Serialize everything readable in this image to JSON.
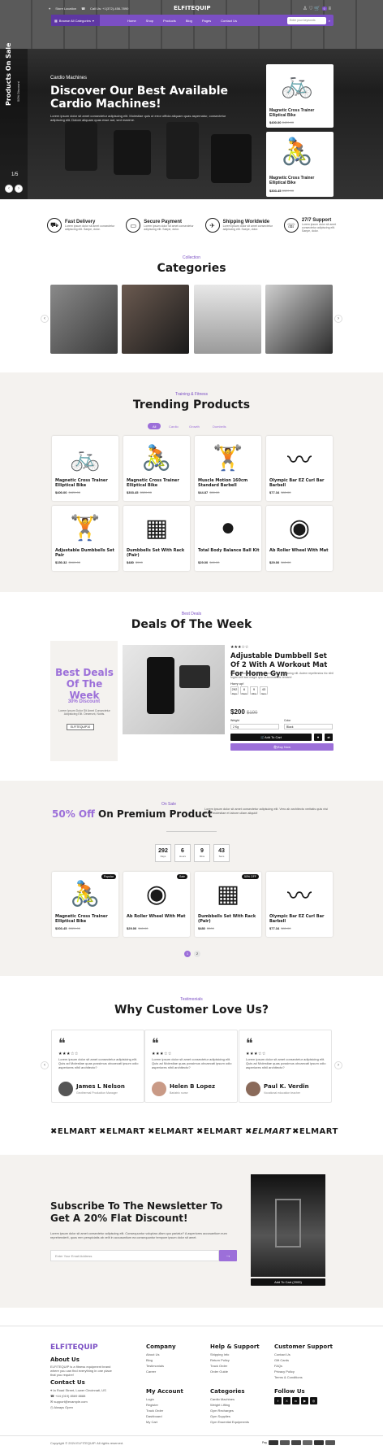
{
  "topbar": {
    "location": "Store Location",
    "phone": "Call Us: +1(372)-456-7890"
  },
  "nav": {
    "logo": "ELFITEQUIP",
    "browse": "Browse All Categories",
    "items": [
      "Home",
      "Shop",
      "Products",
      "Blog",
      "Pages",
      "Contact Us"
    ],
    "search_placeholder": "Enter your keywords",
    "cart_count": "0"
  },
  "hero": {
    "side_title": "Products On Sale",
    "side_sub": "50% Discount",
    "counter": "1/5",
    "eyebrow": "Cardio Machines",
    "title": "Discover Our Best Available Cardio Machines!",
    "desc": "Lorem ipsum dolor sit amet consectetur adipiscing elit. Molestiae quis ut error officia aliquam quas aspernatur, consectetur adipiscing elit. Dolore aliquam quas esse aut, sed maxime.",
    "cards": [
      {
        "name": "Magnetic Cross Trainer Elliptical Bike",
        "price": "$400.00",
        "old": "$420.00"
      },
      {
        "name": "Magnetic Cross Trainer Elliptical Bike",
        "price": "$303.45",
        "old": "$320.00"
      }
    ]
  },
  "features": [
    {
      "title": "Fast Delivery",
      "desc": "Lorem ipsum dolor sit amet consectetur adipiscing elit. Saepe, dolor."
    },
    {
      "title": "Secure Payment",
      "desc": "Lorem ipsum dolor sit amet consectetur adipiscing elit. Saepe, dolor."
    },
    {
      "title": "Shipping Worldwide",
      "desc": "Lorem ipsum dolor sit amet consectetur adipiscing elit. Saepe, dolor."
    },
    {
      "title": "27/7 Support",
      "desc": "Lorem ipsum dolor sit amet consectetur adipiscing elit. Saepe, dolor."
    }
  ],
  "categories": {
    "eyebrow": "Collection",
    "title": "Categories"
  },
  "trending": {
    "eyebrow": "Training & Fitness",
    "title": "Trending Products",
    "tabs": [
      "All",
      "Cardio",
      "Growth",
      "Dumbells"
    ],
    "products": [
      {
        "name": "Magnetic Cross Trainer Elliptical Bike",
        "price": "$400.00",
        "old": "$420.00",
        "icon": "🚲"
      },
      {
        "name": "Magnetic Cross Trainer Elliptical Bike",
        "price": "$303.45",
        "old": "$320.00",
        "icon": "🚴"
      },
      {
        "name": "Muscle Motion 160cm Standard Barbell",
        "price": "$44.87",
        "old": "$50.00",
        "icon": "🏋"
      },
      {
        "name": "Olympic Bar EZ Curl Bar Barbell",
        "price": "$77.34",
        "old": "$80.00",
        "icon": "〰"
      },
      {
        "name": "Adjustable Dumbbells Set Pair",
        "price": "$150.32",
        "old": "$160.00",
        "icon": "🏋"
      },
      {
        "name": "Dumbbells Set With Rack (Pair)",
        "price": "$480",
        "old": "$500",
        "icon": "▦"
      },
      {
        "name": "Total Body Balance Ball Kit",
        "price": "$29.00",
        "old": "$40.00",
        "icon": "●"
      },
      {
        "name": "Ab Roller Wheel With Mat",
        "price": "$29.00",
        "old": "$40.00",
        "icon": "◉"
      }
    ]
  },
  "deals": {
    "eyebrow": "Best Deals",
    "title": "Deals Of The Week",
    "promo_title": "Best Deals Of The Week",
    "promo_discount": "30% Discount",
    "promo_desc": "Lorem Ipsum Dolor Sit Amet Consectetur Adipisicing Elit. Deserunt, Nobis.",
    "promo_code": "ELFITEQUIP10",
    "product": "Adjustable Dumbbell Set Of 2 With A Workout Mat For Home Gym",
    "desc": "Lorem ipsum dolor sit amet consectetur adipiscing elit. Autem repellendus hic nihil fugiat velit sed magni quo ut accusamus veniam!",
    "hurry": "Hurry up!",
    "countdown": [
      "292",
      "6",
      "9",
      "43"
    ],
    "countdown_labels": [
      "Days",
      "Hours",
      "Mins",
      "Secs"
    ],
    "price": "$200",
    "old": "$190",
    "weight_label": "Weight",
    "weight": "2 Kg",
    "color_label": "Color",
    "color": "Black",
    "add": "Add To Cart",
    "buy": "Buy Now"
  },
  "sale": {
    "eyebrow": "On Sale",
    "title_a": "50% Off",
    "title_b": " On Premium Product",
    "desc": "Lorem ipsum dolor sit amet consectetur adipiscing elit. Vero ab architecto veritatis quis nisi ullam molestiae et labore ullam aliquid!",
    "countdown": [
      "292",
      "6",
      "9",
      "43"
    ],
    "labels": [
      "Days",
      "Hours",
      "Mins",
      "Secs"
    ],
    "products": [
      {
        "name": "Magnetic Cross Trainer Elliptical Bike",
        "price": "$303.45",
        "old": "$320.00",
        "badge": "Popular",
        "icon": "🚴"
      },
      {
        "name": "Ab Roller Wheel With Mat",
        "price": "$29.00",
        "old": "$40.00",
        "badge": "Sale",
        "icon": "◉"
      },
      {
        "name": "Dumbbells Set With Rack (Pair)",
        "price": "$480",
        "old": "$500",
        "badge": "50% OFF",
        "icon": "▦"
      },
      {
        "name": "Olympic Bar EZ Curl Bar Barbell",
        "price": "$77.34",
        "old": "$80.00",
        "badge": "",
        "icon": "〰"
      }
    ],
    "pages": [
      "1",
      "2"
    ]
  },
  "testimonials": {
    "eyebrow": "Testimonials",
    "title": "Why Customer Love Us?",
    "text": "Lorem ipsum dolor sit amet consectetur adipisicing elit. Quis ad Molestiae quas possimus obcaecati ipsum odio asperiores nihil architecto?",
    "stars": "★★★☆☆",
    "items": [
      {
        "name": "James L Nelson",
        "role": "Geothermal Production Manager"
      },
      {
        "name": "Helen B Lopez",
        "role": "Bariatric nurse"
      },
      {
        "name": "Paul K. Verdin",
        "role": "Vocational education teacher"
      }
    ]
  },
  "brands": [
    "ELMART",
    "ELMART",
    "ELMART",
    "ELMART",
    "ELMART",
    "ELMART"
  ],
  "newsletter": {
    "title": "Subscribe To The Newsletter To Get A 20% Flat Discount!",
    "desc": "Lorem ipsum dolor sit amet consectetur adipiscing elit. Consequuntur voluptas ullam quo pariatur? A asperiores accusantium eum reprehenderit, quos rem perspiciatis ab velit in accusantium ea consequuntur tempore ipsum dolor sit amet.",
    "placeholder": "Enter Your Email Address",
    "add": "Add To Cart (2000)"
  },
  "footer": {
    "logo": "ELFITEQUIP",
    "about_title": "About Us",
    "about": "ELFITEQUIP is a fitness equipment brand where you can find everything in one place that you require!",
    "contact_title": "Contact Us",
    "address": "Ia Road Street, Lower Cincinnati, US",
    "phone": "+44 (019) 8569 8888",
    "email": "support@example.com",
    "hours": "Always Open",
    "company_title": "Company",
    "company": [
      "About Us",
      "Blog",
      "Testimonials",
      "Career"
    ],
    "help_title": "Help & Support",
    "help": [
      "Shipping Info",
      "Return Policy",
      "Track Order",
      "Order Guide"
    ],
    "service_title": "Customer Support",
    "service": [
      "Contact Us",
      "Gift Cards",
      "FAQs",
      "Privacy Policy",
      "Terms & Conditions"
    ],
    "account_title": "My Account",
    "account": [
      "Login",
      "Register",
      "Track Order",
      "Dashboard",
      "My Cart"
    ],
    "cats_title": "Categories",
    "cats": [
      "Cardio Machines",
      "Weight Lifting",
      "Gym Recharges",
      "Gym Supplies",
      "Gym Essential Equipments"
    ],
    "follow_title": "Follow Us",
    "copyright": "Copyright © 2024 ELFITEQUIP. All rights reserved.",
    "pay": "Pay"
  }
}
